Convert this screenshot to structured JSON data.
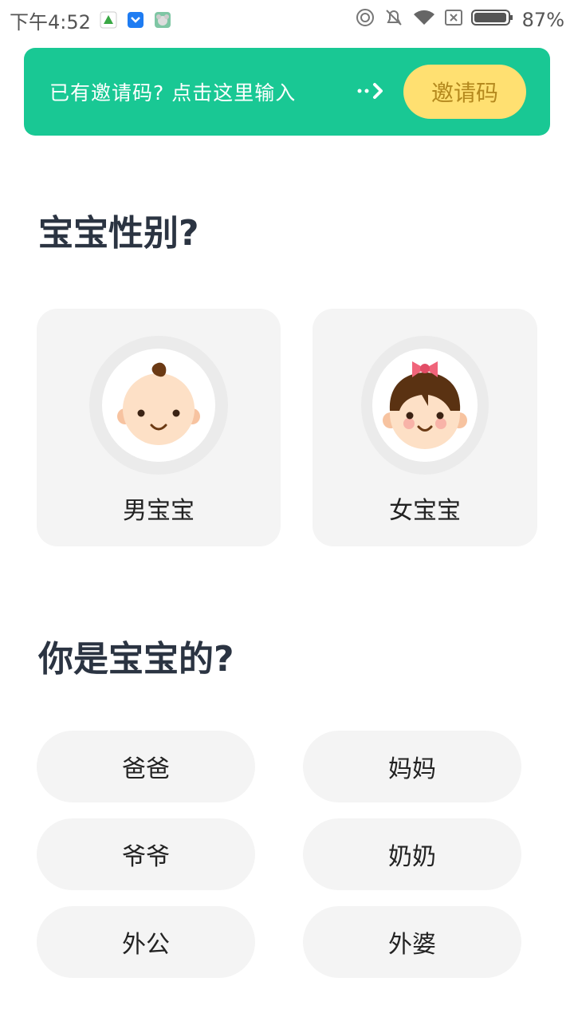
{
  "status_bar": {
    "time": "下午4:52",
    "battery": "87%"
  },
  "banner": {
    "text": "已有邀请码? 点击这里输入",
    "arrow": "··›",
    "button_label": "邀请码"
  },
  "gender_section": {
    "title": "宝宝性别?",
    "options": [
      {
        "label": "男宝宝"
      },
      {
        "label": "女宝宝"
      }
    ]
  },
  "role_section": {
    "title": "你是宝宝的?",
    "options": [
      {
        "label": "爸爸"
      },
      {
        "label": "妈妈"
      },
      {
        "label": "爷爷"
      },
      {
        "label": "奶奶"
      },
      {
        "label": "外公"
      },
      {
        "label": "外婆"
      }
    ]
  },
  "colors": {
    "accent": "#19c894",
    "invite_button": "#ffe071",
    "card_bg": "#f4f4f4"
  }
}
